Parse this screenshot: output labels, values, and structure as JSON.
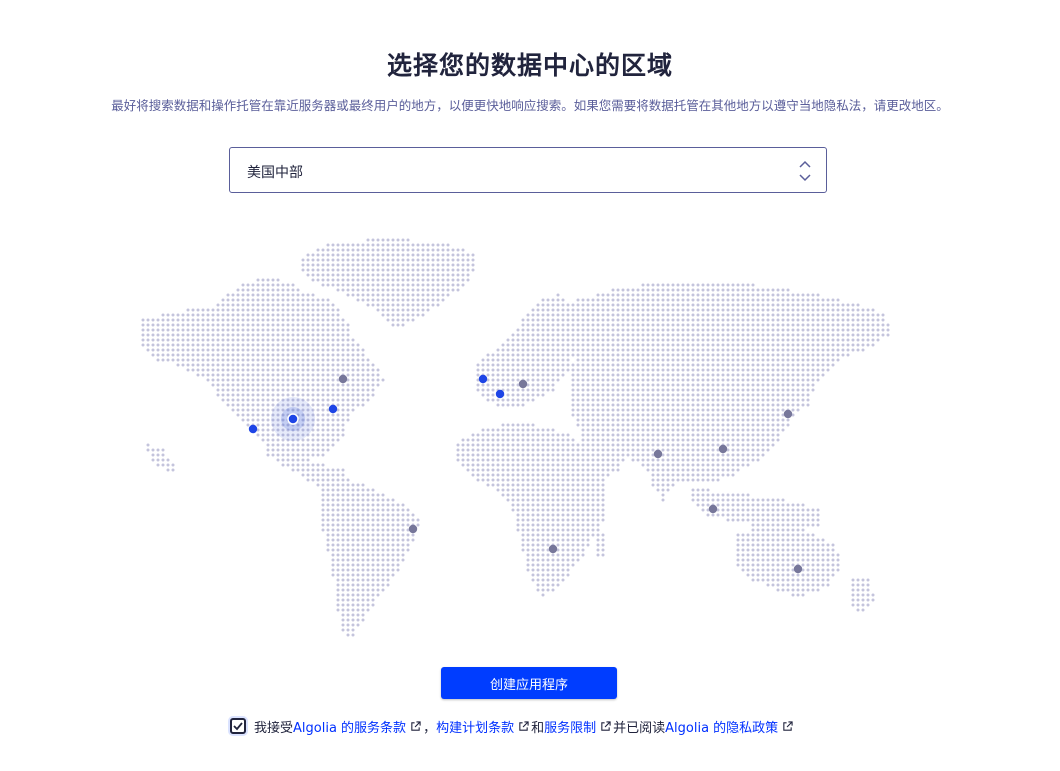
{
  "header": {
    "title": "选择您的数据中心的区域",
    "subtitle": "最好将搜索数据和操作托管在靠近服务器或最终用户的地方，以便更快地响应搜索。如果您需要将数据托管在其他地方以遵守当地隐私法，请更改地区。"
  },
  "region_select": {
    "selected": "美国中部",
    "icon": "chevron-up-down-icon"
  },
  "map": {
    "dot_color": "#c4c4dc",
    "active_color": "#1e45e6",
    "inactive_color": "#77779a",
    "highlight_color": "#2f55d4",
    "markers_active": "blue",
    "markers_inactive": "gray"
  },
  "actions": {
    "create_label": "创建应用程序",
    "button_color": "#003dff"
  },
  "terms": {
    "checked": true,
    "prefix": "我接受",
    "link1": "Algolia 的服务条款",
    "sep1": "，",
    "link2": "构建计划条款",
    "sep2": "和",
    "link3": "服务限制",
    "sep3": "并已阅读",
    "link4": "Algolia 的隐私政策",
    "link_icon": "external-link-icon"
  }
}
